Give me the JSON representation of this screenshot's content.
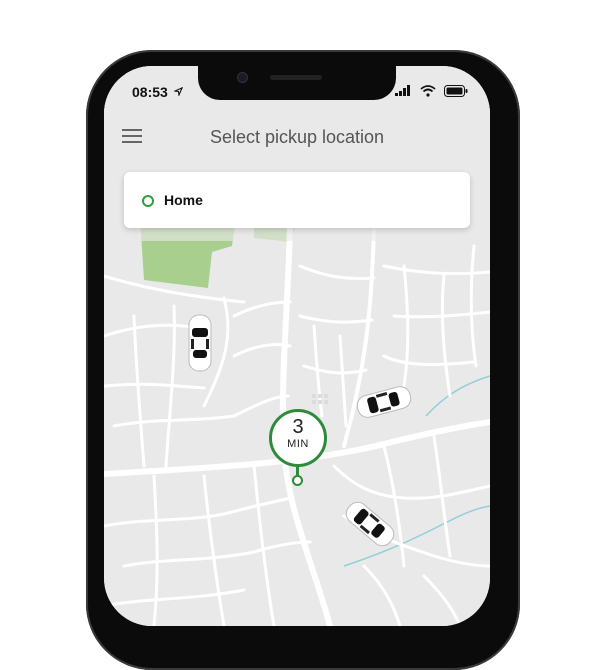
{
  "status_bar": {
    "time": "08:53",
    "location_icon": "location-arrow-icon",
    "signal_icon": "cellular-signal-icon",
    "wifi_icon": "wifi-icon",
    "battery_icon": "battery-icon"
  },
  "header": {
    "title": "Select pickup location",
    "menu_icon": "hamburger-menu-icon"
  },
  "search": {
    "value": "Home",
    "marker_icon": "origin-circle-icon"
  },
  "eta": {
    "number": "3",
    "unit": "MIN"
  },
  "map": {
    "cars": [
      "car-icon",
      "car-icon",
      "car-icon"
    ],
    "colors": {
      "accent": "#2e8b3a",
      "park": "#a9cf8f",
      "road": "#ffffff",
      "land": "#e9e9e9",
      "water": "#8fd1d6"
    }
  }
}
